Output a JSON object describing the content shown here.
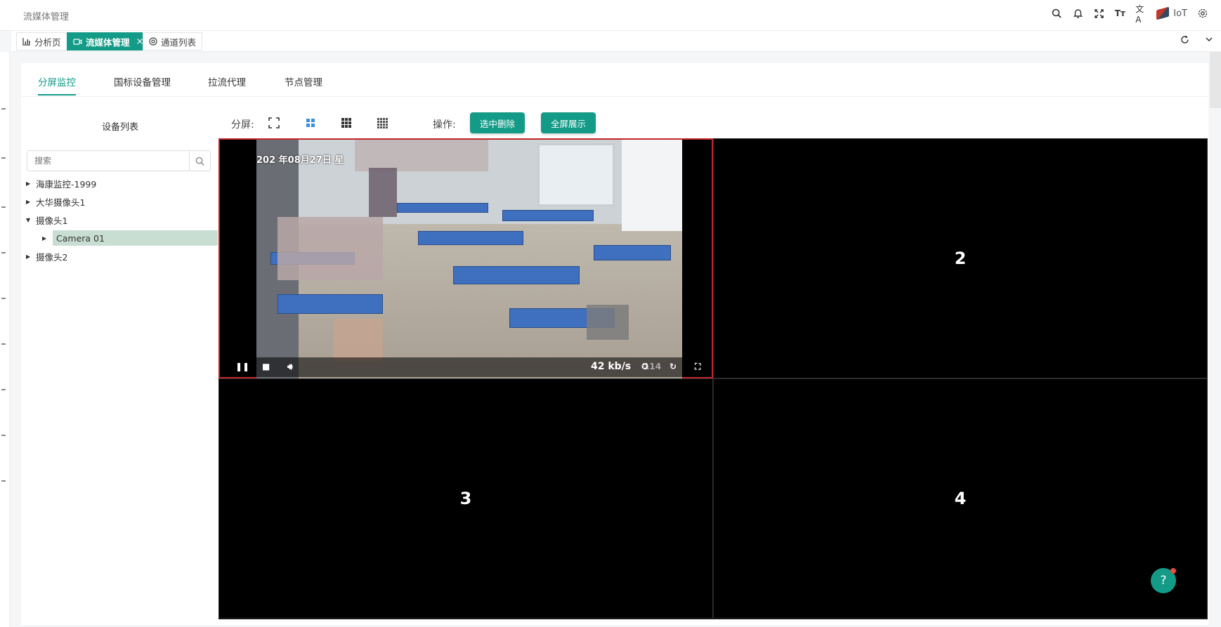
{
  "app_title": "流媒体管理",
  "top_icons": [
    "search-icon",
    "bell-icon",
    "fullscreen-icon",
    "font-size-icon",
    "translate-icon",
    "iot-logo-icon",
    "settings-icon"
  ],
  "brand": "IoT",
  "tags": [
    {
      "label": "分析页",
      "icon": "chart-icon"
    },
    {
      "label": "流媒体管理",
      "icon": "video-icon",
      "closable": true
    },
    {
      "label": "通道列表",
      "icon": "channel-icon"
    }
  ],
  "subtabs": [
    "分屏监控",
    "国标设备管理",
    "拉流代理",
    "节点管理"
  ],
  "device_tree": {
    "title": "设备列表",
    "search_placeholder": "搜索",
    "items": [
      "海康监控-1999",
      "大华摄像头1",
      "摄像头1",
      "Camera 01",
      "摄像头2"
    ]
  },
  "toolbar": {
    "split_label": "分屏:",
    "ops_label": "操作:",
    "delete_label": "选中删除",
    "fullscreen_label": "全屏展示"
  },
  "video": {
    "osd_date": "202 年08月27日 星",
    "speed": "42 kb/s",
    "speed_extra": "114"
  },
  "cells": [
    "2",
    "3",
    "4"
  ],
  "colors": {
    "accent": "#139b87",
    "selected_border": "#c0262d"
  }
}
